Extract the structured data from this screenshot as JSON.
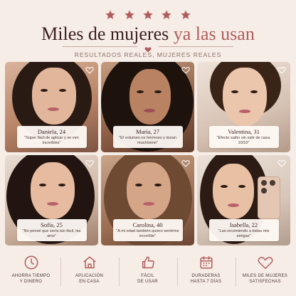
{
  "rating": {
    "stars": 5,
    "star_color": "#b15c5c"
  },
  "headline": {
    "main": "Miles de mujeres",
    "accent": "ya las usan"
  },
  "subtitle": "RESULTADOS REALES, MUJERES REALES",
  "colors": {
    "accent": "#b15c5c",
    "background": "#f6ede6",
    "text": "#3a1f1f"
  },
  "testimonials": [
    {
      "name": "Daniela, 24",
      "quote": "\"Súper fácil de aplicar y se ven increíbles\""
    },
    {
      "name": "María, 27",
      "quote": "\"El volumen es hermoso y duran muchísimo\""
    },
    {
      "name": "Valentina, 31",
      "quote": "\"Efecto salón sin salir de casa. 10/10\""
    },
    {
      "name": "Sofía, 25",
      "quote": "\"No pensé que sería tan fácil, las amo\""
    },
    {
      "name": "Carolina, 40",
      "quote": "\"A mi edad también quiero sentirme increíble\""
    },
    {
      "name": "Isabella, 22",
      "quote": "\"Las recomiendo a todas mis amigas\""
    }
  ],
  "features": [
    {
      "icon": "clock-icon",
      "line1": "AHORRA TIEMPO",
      "line2": "Y DINERO"
    },
    {
      "icon": "home-icon",
      "line1": "APLICACIÓN",
      "line2": "EN CASA"
    },
    {
      "icon": "thumbs-up-icon",
      "line1": "FÁCIL",
      "line2": "DE USAR"
    },
    {
      "icon": "calendar-icon",
      "line1": "DURADERAS",
      "line2": "HASTA 7 DÍAS"
    },
    {
      "icon": "heart-icon",
      "line1": "MILES DE MUJERES",
      "line2": "SATISFECHAS"
    }
  ]
}
